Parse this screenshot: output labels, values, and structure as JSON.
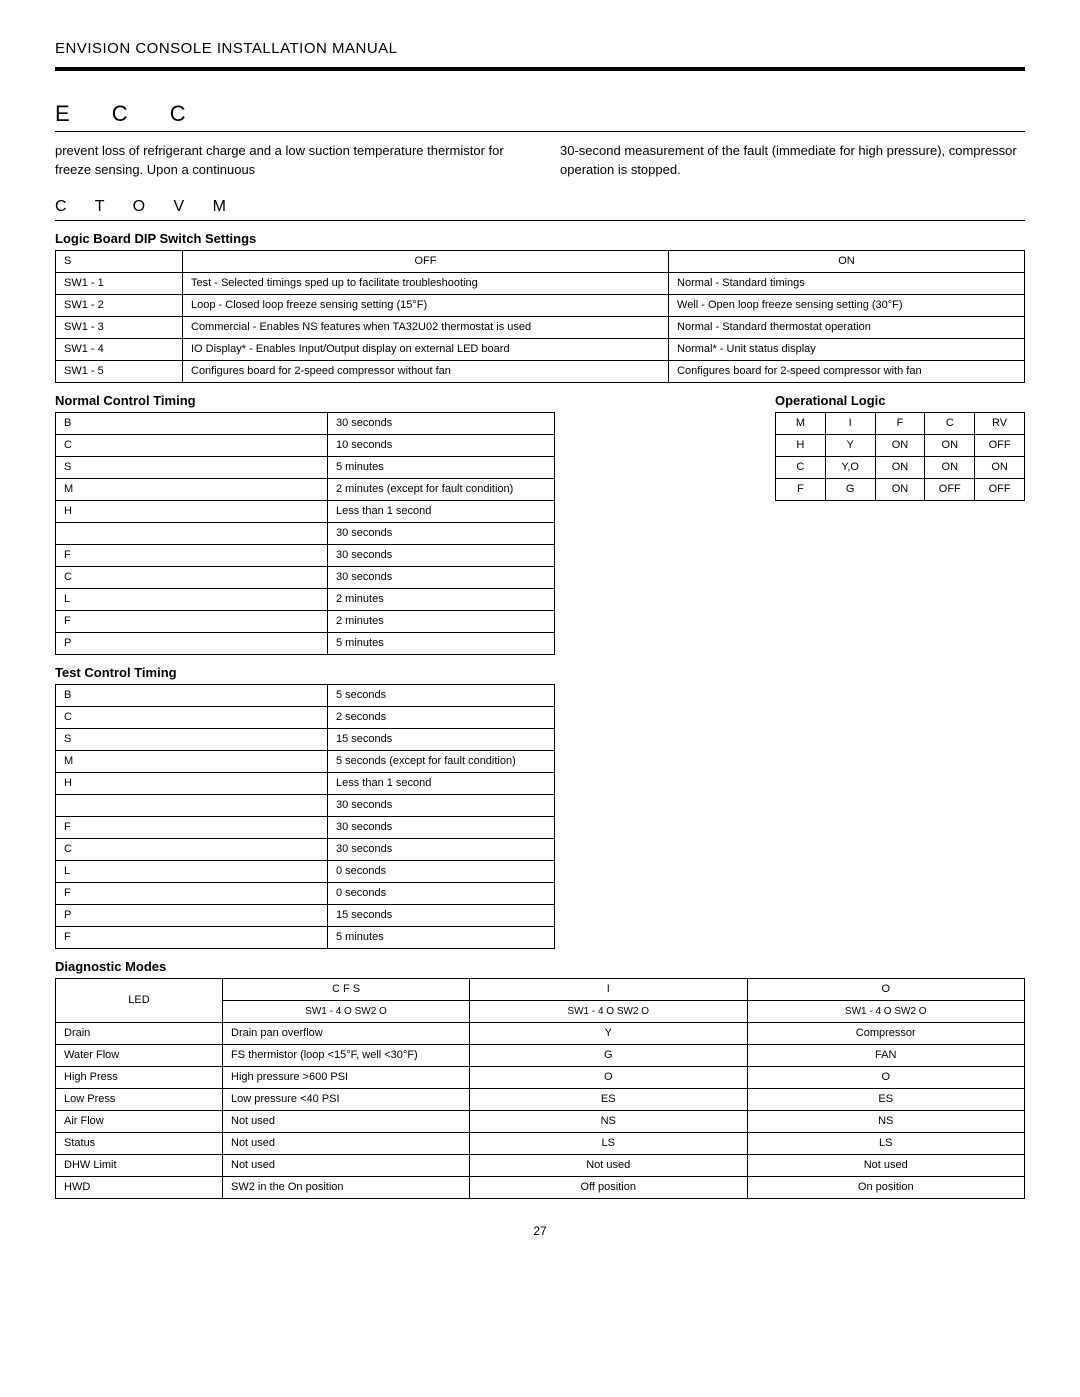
{
  "header": {
    "title": "ENVISION CONSOLE INSTALLATION MANUAL"
  },
  "section_title_spaced": "E C C",
  "intro": {
    "left": "prevent loss of refrigerant charge and a low suction temperature thermistor for freeze sensing. Upon a continuous",
    "right": "30-second measurement of the fault (immediate for high pressure), compressor operation is stopped."
  },
  "subsection_title_spaced": "C T O V M",
  "dip": {
    "heading": "Logic Board DIP Switch Settings",
    "head": {
      "s": "S",
      "off": "OFF",
      "on": "ON"
    },
    "rows": [
      {
        "s": "SW1 - 1",
        "off": "Test - Selected timings sped up to facilitate troubleshooting",
        "on": "Normal - Standard timings"
      },
      {
        "s": "SW1 - 2",
        "off": "Loop - Closed loop freeze sensing setting (15°F)",
        "on": "Well - Open loop freeze sensing setting (30°F)"
      },
      {
        "s": "SW1 - 3",
        "off": "Commercial - Enables NS features when TA32U02 thermostat is used",
        "on": "Normal - Standard thermostat operation"
      },
      {
        "s": "SW1 - 4",
        "off": "IO Display* - Enables Input/Output display on external LED board",
        "on": "Normal* - Unit status display"
      },
      {
        "s": "SW1 - 5",
        "off": "Configures board for 2-speed compressor without fan",
        "on": "Configures board for 2-speed compressor with fan"
      }
    ]
  },
  "normal_timing": {
    "heading": "Normal Control Timing",
    "rows": [
      {
        "a": "B",
        "b": "30 seconds"
      },
      {
        "a": "C",
        "b": "10 seconds"
      },
      {
        "a": "S",
        "b": "5 minutes"
      },
      {
        "a": "M",
        "b": "2 minutes (except for fault condition)"
      },
      {
        "a": "H",
        "b": "Less than 1 second"
      },
      {
        "a": "",
        "b": "30 seconds"
      },
      {
        "a": "F",
        "b": "30 seconds"
      },
      {
        "a": "C",
        "b": "30 seconds"
      },
      {
        "a": "L",
        "b": "2 minutes"
      },
      {
        "a": "F",
        "b": "2 minutes"
      },
      {
        "a": "P",
        "b": "5 minutes"
      }
    ]
  },
  "op_logic": {
    "heading": "Operational Logic",
    "head": [
      "M",
      "I",
      "F",
      "C",
      "RV"
    ],
    "rows": [
      [
        "H",
        "Y",
        "ON",
        "ON",
        "OFF"
      ],
      [
        "C",
        "Y,O",
        "ON",
        "ON",
        "ON"
      ],
      [
        "F",
        "G",
        "ON",
        "OFF",
        "OFF"
      ]
    ]
  },
  "test_timing": {
    "heading": "Test Control Timing",
    "rows": [
      {
        "a": "B",
        "b": "5 seconds"
      },
      {
        "a": "C",
        "b": "2 seconds"
      },
      {
        "a": "S",
        "b": "15 seconds"
      },
      {
        "a": "M",
        "b": "5 seconds (except for fault condition)"
      },
      {
        "a": "H",
        "b": "Less than 1 second"
      },
      {
        "a": "",
        "b": "30 seconds"
      },
      {
        "a": "F",
        "b": "30 seconds"
      },
      {
        "a": "C",
        "b": "30 seconds"
      },
      {
        "a": "L",
        "b": "0 seconds"
      },
      {
        "a": "F",
        "b": "0 seconds"
      },
      {
        "a": "P",
        "b": "15 seconds"
      },
      {
        "a": "F",
        "b": "5 minutes"
      }
    ]
  },
  "diag": {
    "heading": "Diagnostic Modes",
    "head": {
      "led": "LED",
      "cond_top": "C        F        S",
      "cond_sub": "SW1 -    4 O        SW2 O",
      "in_top": "I",
      "in_sub": "SW1 -    4 O        SW2 O",
      "out_top": "O",
      "out_sub": "SW1 -    4 O        SW2 O"
    },
    "rows": [
      {
        "led": "Drain",
        "cond": "Drain pan overflow",
        "in": "Y",
        "out": "Compressor"
      },
      {
        "led": "Water Flow",
        "cond": "FS thermistor (loop <15°F, well <30°F)",
        "in": "G",
        "out": "FAN"
      },
      {
        "led": "High Press",
        "cond": "High pressure >600 PSI",
        "in": "O",
        "out": "O"
      },
      {
        "led": "Low Press",
        "cond": "Low pressure <40 PSI",
        "in": "ES",
        "out": "ES"
      },
      {
        "led": "Air Flow",
        "cond": "Not used",
        "in": "NS",
        "out": "NS"
      },
      {
        "led": "Status",
        "cond": "Not used",
        "in": "LS",
        "out": "LS"
      },
      {
        "led": "DHW Limit",
        "cond": "Not used",
        "in": "Not used",
        "out": "Not used"
      },
      {
        "led": "HWD",
        "cond": "SW2 in the On position",
        "in": "Off position",
        "out": "On position"
      }
    ]
  },
  "page_number": "27"
}
